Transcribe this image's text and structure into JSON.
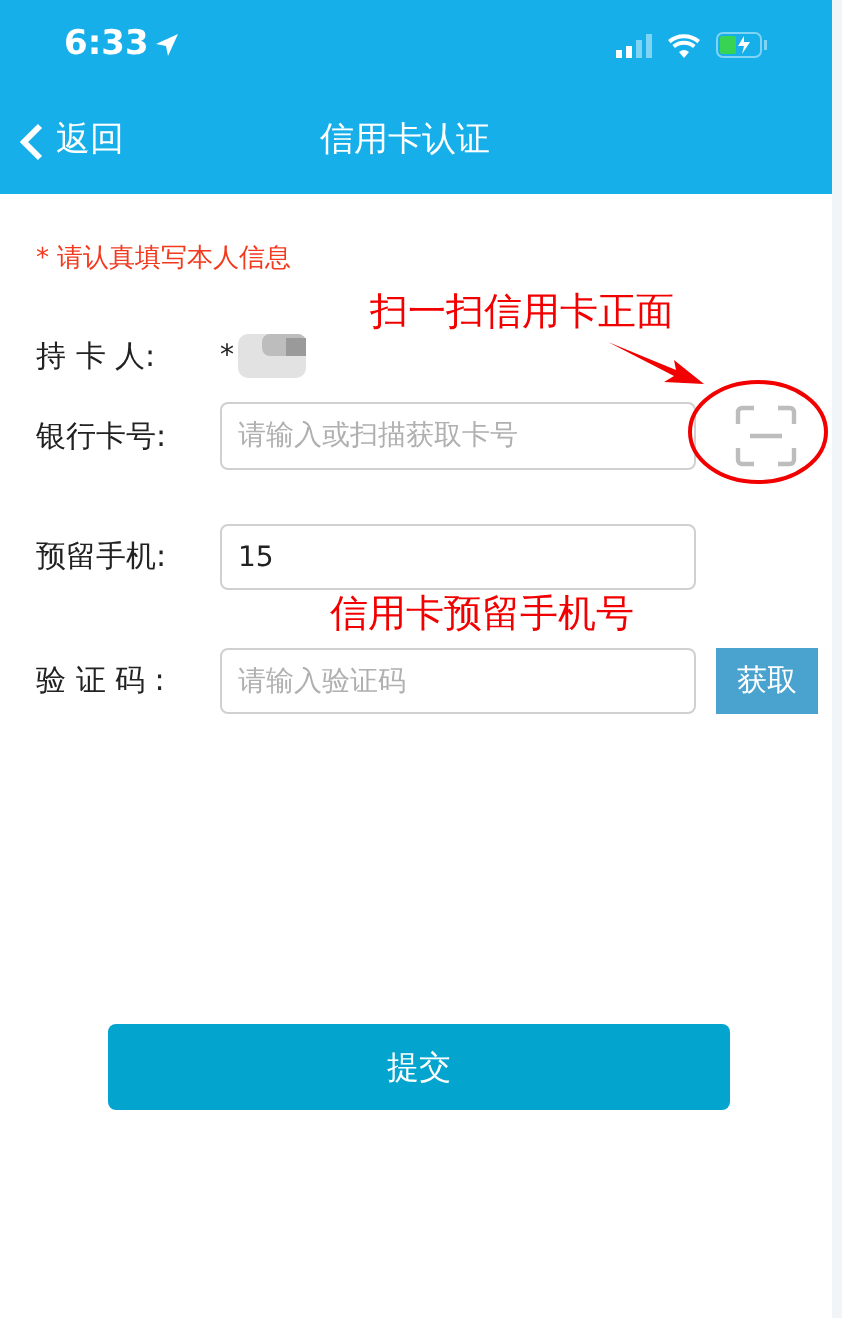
{
  "status_bar": {
    "time": "6:33"
  },
  "nav": {
    "back": "返回",
    "title": "信用卡认证"
  },
  "notice": "* 请认真填写本人信息",
  "form": [
    {
      "kind": "text",
      "label": "持 卡 人:",
      "value": "*"
    },
    {
      "kind": "scan",
      "label": "银行卡号:",
      "placeholder": "请输入或扫描获取卡号"
    },
    {
      "kind": "input",
      "label": "预留手机:",
      "value": "15"
    },
    {
      "kind": "code",
      "label": "验 证 码 :",
      "placeholder": "请输入验证码",
      "button": "获取"
    }
  ],
  "submit": "提交",
  "annotations": [
    {
      "kind": "scan",
      "text": "扫一扫信用卡正面"
    },
    {
      "kind": "phone",
      "text": "信用卡预留手机号"
    }
  ]
}
